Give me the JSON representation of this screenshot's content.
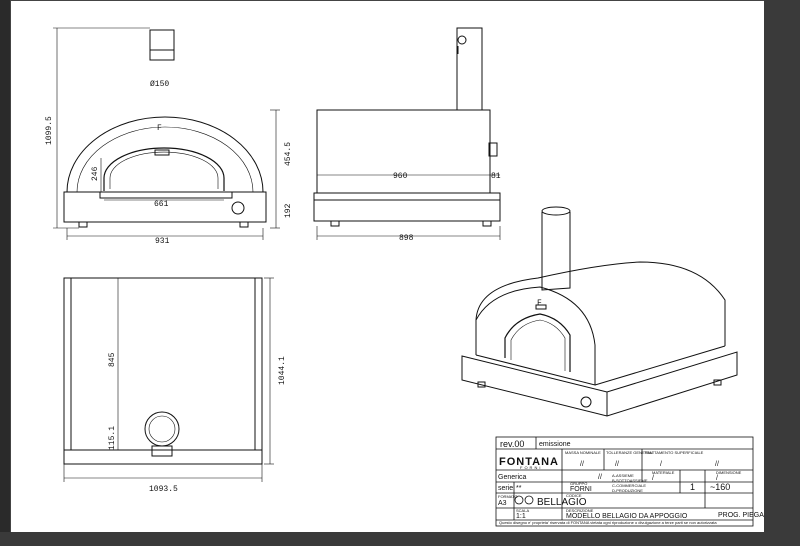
{
  "dimensions": {
    "total_height": "1099.5",
    "chimney_diameter": "Ø150",
    "dome_height": "454.5",
    "door_height": "246",
    "door_width": "661",
    "base_height": "192",
    "front_width": "931",
    "side_depth": "960",
    "handle_depth": "81",
    "base_depth": "898",
    "inner_depth": "845",
    "overall_depth": "1044.1",
    "flue_offset": "115.1",
    "overall_width": "1093.5"
  },
  "title_block": {
    "revision": "rev.00",
    "revision_desc": "emissione",
    "company_logo": "FONTANA",
    "company_logo_sub": "FORNI",
    "hdr_col1": "MASSA NOMINALE",
    "hdr_col2": "TOLLERANZE GENERALI",
    "hdr_col3": "TRATTAMENTO SUPERFICIALE",
    "val1": "//",
    "val2": "//",
    "val3": "/",
    "val4": "//",
    "generica": "Generica",
    "generica_val": "//",
    "materiale_label": "MATERIALE",
    "materiale_val": "/",
    "dimensione_label": "DIMENSIONE",
    "dimensione_val": "/",
    "serie_label": "serie",
    "serie_val": "**",
    "gruppo_label": "GRUPPO",
    "gruppo_val": "FORNI",
    "notes_line1": "A-ASSIEME",
    "notes_line2": "B-SOTTOASSIEME",
    "notes_line3": "C-COMMERCIALE",
    "notes_line4": "D-PRODUZIONE",
    "quantity": "1",
    "weight": "~160",
    "format_label": "FORMATO",
    "format_val": "A3",
    "code_label": "CODICE",
    "product_name": "BELLAGIO",
    "scale_label": "SCALA",
    "scale_val": "1:1",
    "description_label": "DESCRIZIONE",
    "description": "MODELLO BELLAGIO DA APPOGGIO",
    "prog_label": "PROG. PIEGA",
    "disclaimer": "Questo disegno e' proprieta' riservata di FONTANA vietata ogni riproduzione o divulgazione a terze parti se non autorizzata"
  }
}
